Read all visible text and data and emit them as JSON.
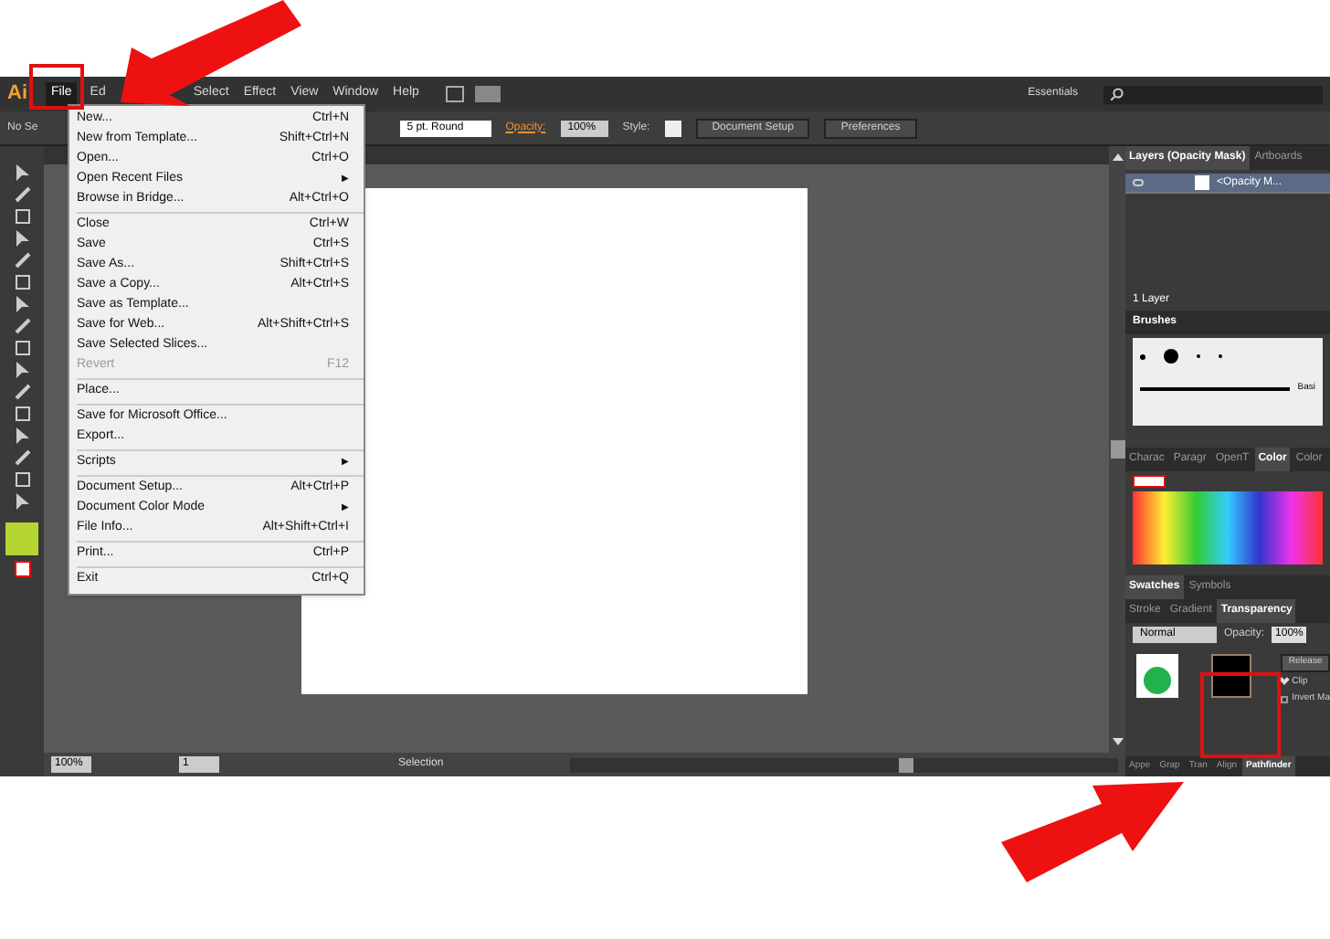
{
  "app": {
    "logo": "Ai",
    "menus": [
      {
        "label": "File",
        "selected": true
      },
      {
        "label": "Ed",
        "selected": false
      },
      {
        "label": "Select",
        "selected": false
      },
      {
        "label": "Effect",
        "selected": false
      },
      {
        "label": "View",
        "selected": false
      },
      {
        "label": "Window",
        "selected": false
      },
      {
        "label": "Help",
        "selected": false
      }
    ],
    "workspace": "Essentials"
  },
  "control_bar": {
    "selection": "No Se",
    "brush": "5 pt. Round",
    "opacity_label": "Opacity:",
    "opacity": "100%",
    "style_label": "Style:",
    "buttons": [
      "Document Setup",
      "Preferences"
    ]
  },
  "file_menu": [
    [
      {
        "label": "New...",
        "shortcut": "Ctrl+N",
        "disabled": false
      },
      {
        "label": "New from Template...",
        "shortcut": "Shift+Ctrl+N",
        "disabled": false
      },
      {
        "label": "Open...",
        "shortcut": "Ctrl+O",
        "disabled": false
      },
      {
        "label": "Open Recent Files",
        "submenu_arrow": "▶",
        "disabled": false
      },
      {
        "label": "Browse in Bridge...",
        "shortcut": "Alt+Ctrl+O",
        "disabled": false
      }
    ],
    [
      {
        "label": "Close",
        "shortcut": "Ctrl+W",
        "disabled": false
      },
      {
        "label": "Save",
        "shortcut": "Ctrl+S",
        "disabled": false
      },
      {
        "label": "Save As...",
        "shortcut": "Shift+Ctrl+S",
        "disabled": false
      },
      {
        "label": "Save a Copy...",
        "shortcut": "Alt+Ctrl+S",
        "disabled": false
      },
      {
        "label": "Save as Template...",
        "disabled": false
      },
      {
        "label": "Save for Web...",
        "shortcut": "Alt+Shift+Ctrl+S",
        "disabled": false
      },
      {
        "label": "Save Selected Slices...",
        "disabled": false
      },
      {
        "label": "Revert",
        "shortcut": "F12",
        "disabled": true
      }
    ],
    [
      {
        "label": "Place...",
        "disabled": false
      }
    ],
    [
      {
        "label": "Save for Microsoft Office...",
        "disabled": false
      },
      {
        "label": "Export...",
        "disabled": false
      }
    ],
    [
      {
        "label": "Scripts",
        "submenu_arrow": "▶",
        "disabled": false
      }
    ],
    [
      {
        "label": "Document Setup...",
        "shortcut": "Alt+Ctrl+P",
        "disabled": false
      },
      {
        "label": "Document Color Mode",
        "submenu_arrow": "▶",
        "disabled": false
      },
      {
        "label": "File Info...",
        "shortcut": "Alt+Shift+Ctrl+I",
        "disabled": false
      }
    ],
    [
      {
        "label": "Print...",
        "shortcut": "Ctrl+P",
        "disabled": false
      }
    ],
    [
      {
        "label": "Exit",
        "shortcut": "Ctrl+Q",
        "disabled": false
      }
    ]
  ],
  "layers_panel": {
    "tabs": [
      {
        "label": "Layers (Opacity Mask)",
        "selected": true
      },
      {
        "label": "Artboards",
        "selected": false
      }
    ],
    "row": "<Opacity M...",
    "count": "1 Layer"
  },
  "brushes_panel": {
    "title": "Brushes",
    "brush_name": "Basi"
  },
  "color_panel": {
    "tabs": [
      {
        "label": "Charac",
        "selected": false
      },
      {
        "label": "Paragr",
        "selected": false
      },
      {
        "label": "OpenT",
        "selected": false
      },
      {
        "label": "Color",
        "selected": true
      },
      {
        "label": "Color",
        "selected": false
      }
    ]
  },
  "swatches_tabs": [
    {
      "label": "Swatches",
      "selected": true
    },
    {
      "label": "Symbols",
      "selected": false
    }
  ],
  "transparency_panel": {
    "tabs": [
      {
        "label": "Stroke",
        "selected": false
      },
      {
        "label": "Gradient",
        "selected": false
      },
      {
        "label": "Transparency",
        "selected": true
      }
    ],
    "blend_mode": "Normal",
    "opacity_label": "Opacity:",
    "opacity": "100%",
    "release": "Release",
    "clip": "Clip",
    "clip_checked": true,
    "invert": "Invert Ma",
    "invert_checked": false
  },
  "bottom_tabs": [
    {
      "label": "Appe",
      "selected": false
    },
    {
      "label": "Grap",
      "selected": false
    },
    {
      "label": "Tran",
      "selected": false
    },
    {
      "label": "Align",
      "selected": false
    },
    {
      "label": "Pathfinder",
      "selected": true
    }
  ],
  "status_bar": {
    "zoom": "100%",
    "artboard": "1",
    "tool": "Selection"
  }
}
